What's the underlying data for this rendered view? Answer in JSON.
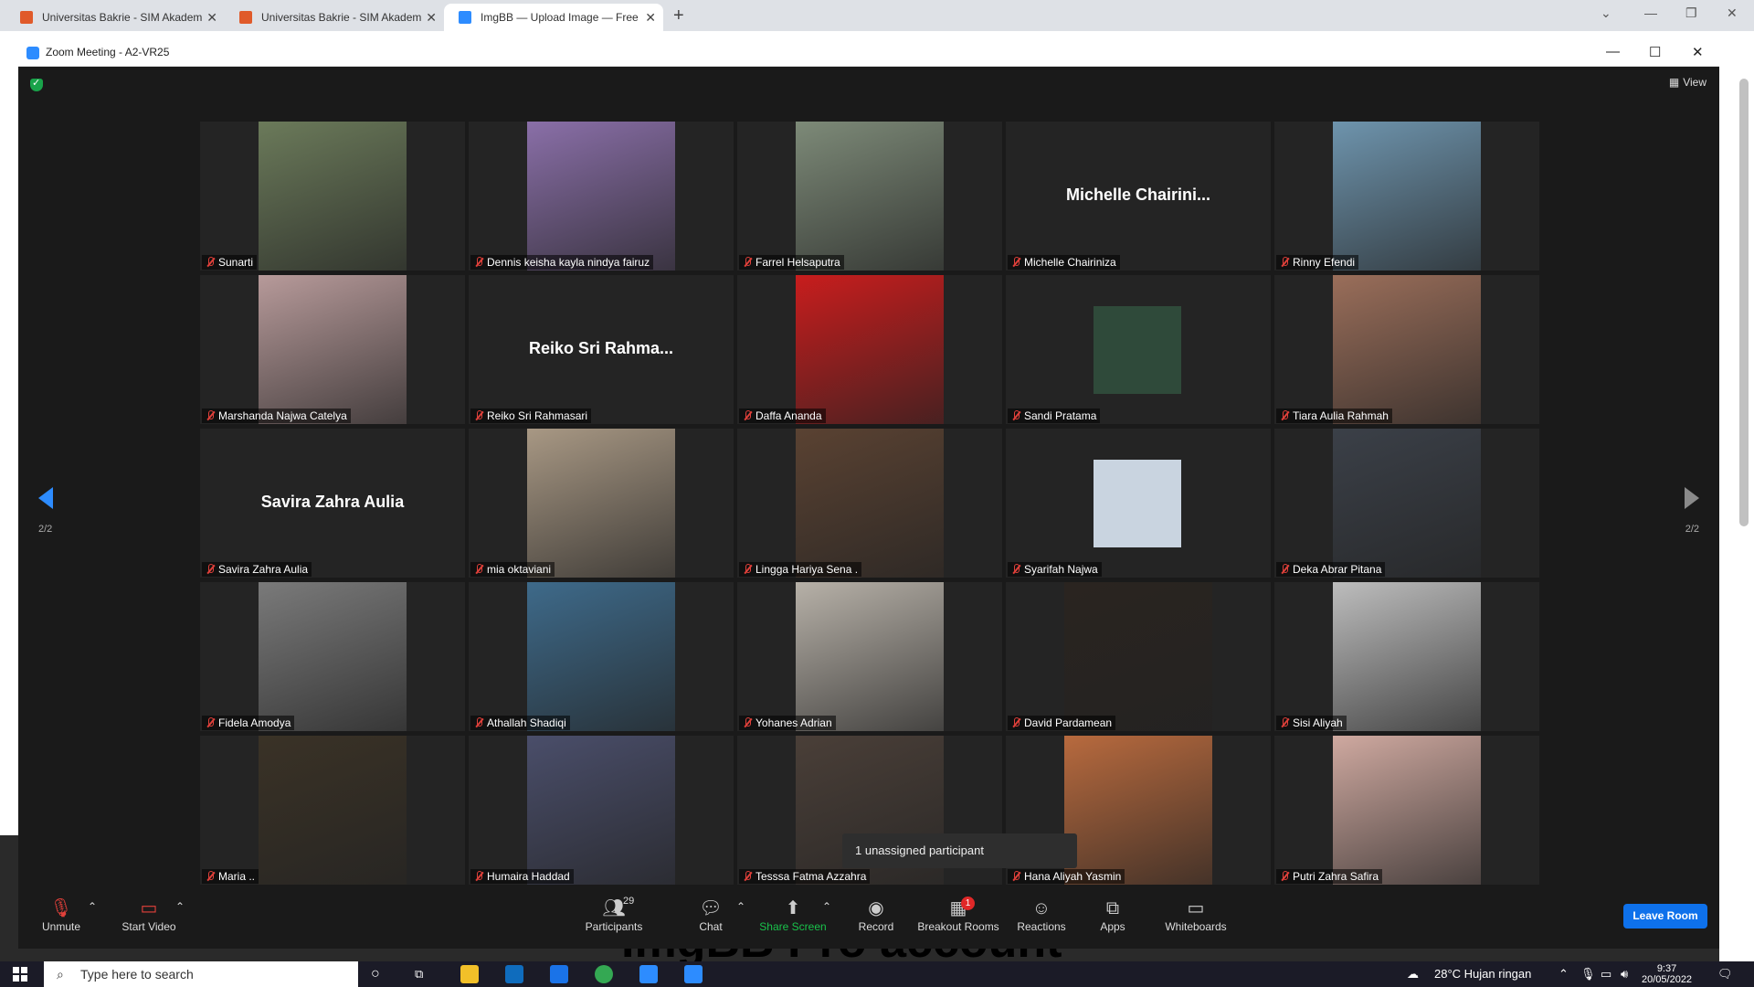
{
  "browser": {
    "tabs": [
      {
        "label": "Universitas Bakrie - SIM Akadem",
        "active": false
      },
      {
        "label": "Universitas Bakrie - SIM Akadem",
        "active": false
      },
      {
        "label": "ImgBB — Upload Image — Free",
        "active": true
      }
    ],
    "background_banner": "ImgBB Pro account"
  },
  "zoom": {
    "title": "Zoom Meeting - A2-VR25",
    "view_label": "View",
    "page_indicator_left": "2/2",
    "page_indicator_right": "2/2",
    "tooltip": "1 unassigned participant",
    "participants": [
      {
        "name": "Sunarti",
        "display": "photo",
        "color": "#6b7a5a"
      },
      {
        "name": "Dennis keisha kayla nindya fairuz",
        "display": "photo",
        "color": "#8a6fa8"
      },
      {
        "name": "Farrel Helsaputra",
        "display": "photo",
        "color": "#7d8a78"
      },
      {
        "name": "Michelle Chairiniza",
        "display": "name",
        "big_name": "Michelle  Chairini...",
        "color": ""
      },
      {
        "name": "Rinny Efendi",
        "display": "photo",
        "color": "#6e94ad"
      },
      {
        "name": "Marshanda Najwa Catelya",
        "display": "photo",
        "color": "#b79a9a"
      },
      {
        "name": "Reiko Sri Rahmasari",
        "display": "name",
        "big_name": "Reiko  Sri  Rahma...",
        "color": ""
      },
      {
        "name": "Daffa Ananda",
        "display": "photo",
        "color": "#c81d1d"
      },
      {
        "name": "Sandi Pratama",
        "display": "small",
        "color": "#2f4a3a"
      },
      {
        "name": "Tiara Aulia Rahmah",
        "display": "photo",
        "color": "#9a6e5a"
      },
      {
        "name": "Savira Zahra Aulia",
        "display": "name",
        "big_name": "Savira Zahra Aulia",
        "color": ""
      },
      {
        "name": "mia oktaviani",
        "display": "photo",
        "color": "#a89884"
      },
      {
        "name": "Lingga Hariya Sena .",
        "display": "photo",
        "color": "#5a4232"
      },
      {
        "name": "Syarifah Najwa",
        "display": "small",
        "color": "#c9d4e0"
      },
      {
        "name": "Deka Abrar Pitana",
        "display": "photo",
        "color": "#3b4048"
      },
      {
        "name": "Fidela Amodya",
        "display": "photo",
        "color": "#7a7a7a"
      },
      {
        "name": "Athallah Shadiqi",
        "display": "photo",
        "color": "#3e6a8a"
      },
      {
        "name": "Yohanes Adrian",
        "display": "photo",
        "color": "#b7b1a8"
      },
      {
        "name": "David Pardamean",
        "display": "photo",
        "color": "#2a2420"
      },
      {
        "name": "Sisi Aliyah",
        "display": "photo",
        "color": "#bdbdbd"
      },
      {
        "name": "Maria ..",
        "display": "photo",
        "color": "#3a3226"
      },
      {
        "name": "Humaira Haddad",
        "display": "photo",
        "color": "#4a4e6a"
      },
      {
        "name": "Tesssa Fatma Azzahra",
        "display": "photo",
        "color": "#4a3f38"
      },
      {
        "name": "Hana Aliyah Yasmin",
        "display": "photo",
        "color": "#b86a3e"
      },
      {
        "name": "Putri Zahra Safira",
        "display": "photo",
        "color": "#cfa9a0"
      }
    ],
    "toolbar": {
      "unmute": "Unmute",
      "start_video": "Start Video",
      "participants": "Participants",
      "participants_count": "29",
      "chat": "Chat",
      "share_screen": "Share Screen",
      "record": "Record",
      "breakout_rooms": "Breakout Rooms",
      "breakout_badge": "1",
      "reactions": "Reactions",
      "apps": "Apps",
      "whiteboards": "Whiteboards",
      "leave_room": "Leave Room"
    }
  },
  "taskbar": {
    "search_placeholder": "Type here to search",
    "weather": "28°C  Hujan ringan",
    "time": "9:37",
    "date": "20/05/2022"
  }
}
